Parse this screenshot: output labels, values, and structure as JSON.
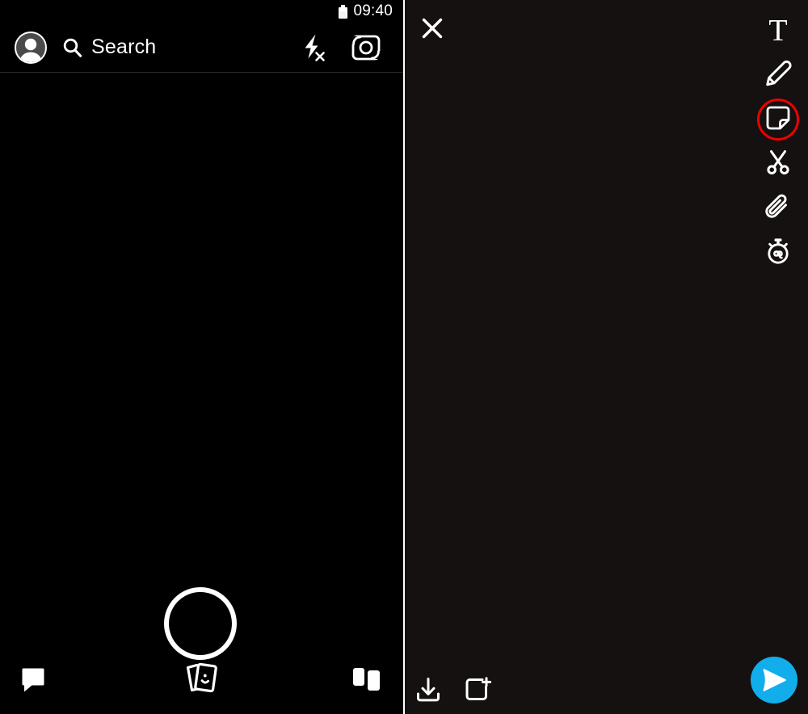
{
  "screens": {
    "camera": {
      "name": "Snapchat camera screen",
      "status_bar": {
        "time": "09:40",
        "battery_icon": "battery-icon"
      },
      "search": {
        "avatar_icon": "profile-avatar-icon",
        "search_icon": "search-icon",
        "placeholder": "Search",
        "label": "Search"
      },
      "top_tools": [
        {
          "name": "flash-off-icon",
          "label": "Flash off"
        },
        {
          "name": "camera-flip-icon",
          "label": "Flip camera"
        }
      ],
      "shutter": {
        "name": "shutter-button",
        "label": "Capture"
      },
      "bottom_tools": [
        {
          "name": "chat-icon",
          "label": "Chat"
        },
        {
          "name": "memories-icon",
          "label": "Memories"
        },
        {
          "name": "stories-icon",
          "label": "Stories"
        }
      ]
    },
    "editor": {
      "name": "Snap editor screen",
      "close": {
        "name": "close-icon",
        "label": "Close"
      },
      "tools": [
        {
          "name": "text-tool",
          "glyph": "T",
          "label": "Text",
          "selected": false
        },
        {
          "name": "draw-tool",
          "glyph": "pencil-icon",
          "label": "Draw",
          "selected": false
        },
        {
          "name": "sticker-tool",
          "glyph": "sticker-icon",
          "label": "Stickers",
          "selected": true
        },
        {
          "name": "scissors-tool",
          "glyph": "scissors-icon",
          "label": "Scissors",
          "selected": false
        },
        {
          "name": "attach-tool",
          "glyph": "paperclip-icon",
          "label": "Attach link",
          "selected": false
        },
        {
          "name": "timer-tool",
          "glyph": "stopwatch-infinity-icon",
          "label": "Timer",
          "selected": false
        }
      ],
      "bottom_tools": [
        {
          "name": "save-icon",
          "label": "Save"
        },
        {
          "name": "add-to-story-icon",
          "label": "Add to Story"
        }
      ],
      "send": {
        "name": "send-button",
        "label": "Send To"
      }
    }
  },
  "colors": {
    "highlight": "#ee0000",
    "send_blue": "#12adeb",
    "background": "#000000",
    "editor_background": "#141110",
    "foreground": "#ffffff"
  }
}
